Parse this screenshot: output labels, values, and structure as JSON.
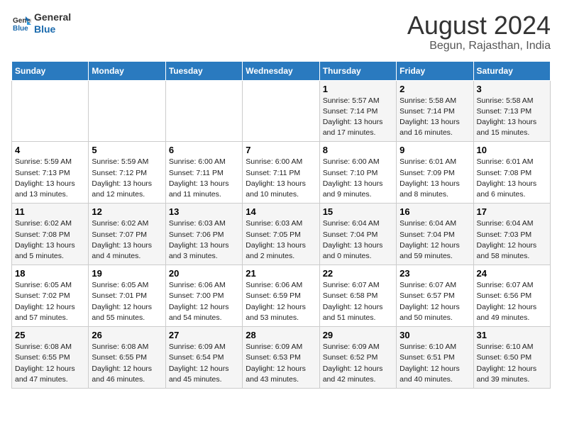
{
  "logo": {
    "line1": "General",
    "line2": "Blue"
  },
  "title": "August 2024",
  "subtitle": "Begun, Rajasthan, India",
  "header_days": [
    "Sunday",
    "Monday",
    "Tuesday",
    "Wednesday",
    "Thursday",
    "Friday",
    "Saturday"
  ],
  "weeks": [
    [
      {
        "day": "",
        "info": ""
      },
      {
        "day": "",
        "info": ""
      },
      {
        "day": "",
        "info": ""
      },
      {
        "day": "",
        "info": ""
      },
      {
        "day": "1",
        "info": "Sunrise: 5:57 AM\nSunset: 7:14 PM\nDaylight: 13 hours\nand 17 minutes."
      },
      {
        "day": "2",
        "info": "Sunrise: 5:58 AM\nSunset: 7:14 PM\nDaylight: 13 hours\nand 16 minutes."
      },
      {
        "day": "3",
        "info": "Sunrise: 5:58 AM\nSunset: 7:13 PM\nDaylight: 13 hours\nand 15 minutes."
      }
    ],
    [
      {
        "day": "4",
        "info": "Sunrise: 5:59 AM\nSunset: 7:13 PM\nDaylight: 13 hours\nand 13 minutes."
      },
      {
        "day": "5",
        "info": "Sunrise: 5:59 AM\nSunset: 7:12 PM\nDaylight: 13 hours\nand 12 minutes."
      },
      {
        "day": "6",
        "info": "Sunrise: 6:00 AM\nSunset: 7:11 PM\nDaylight: 13 hours\nand 11 minutes."
      },
      {
        "day": "7",
        "info": "Sunrise: 6:00 AM\nSunset: 7:11 PM\nDaylight: 13 hours\nand 10 minutes."
      },
      {
        "day": "8",
        "info": "Sunrise: 6:00 AM\nSunset: 7:10 PM\nDaylight: 13 hours\nand 9 minutes."
      },
      {
        "day": "9",
        "info": "Sunrise: 6:01 AM\nSunset: 7:09 PM\nDaylight: 13 hours\nand 8 minutes."
      },
      {
        "day": "10",
        "info": "Sunrise: 6:01 AM\nSunset: 7:08 PM\nDaylight: 13 hours\nand 6 minutes."
      }
    ],
    [
      {
        "day": "11",
        "info": "Sunrise: 6:02 AM\nSunset: 7:08 PM\nDaylight: 13 hours\nand 5 minutes."
      },
      {
        "day": "12",
        "info": "Sunrise: 6:02 AM\nSunset: 7:07 PM\nDaylight: 13 hours\nand 4 minutes."
      },
      {
        "day": "13",
        "info": "Sunrise: 6:03 AM\nSunset: 7:06 PM\nDaylight: 13 hours\nand 3 minutes."
      },
      {
        "day": "14",
        "info": "Sunrise: 6:03 AM\nSunset: 7:05 PM\nDaylight: 13 hours\nand 2 minutes."
      },
      {
        "day": "15",
        "info": "Sunrise: 6:04 AM\nSunset: 7:04 PM\nDaylight: 13 hours\nand 0 minutes."
      },
      {
        "day": "16",
        "info": "Sunrise: 6:04 AM\nSunset: 7:04 PM\nDaylight: 12 hours\nand 59 minutes."
      },
      {
        "day": "17",
        "info": "Sunrise: 6:04 AM\nSunset: 7:03 PM\nDaylight: 12 hours\nand 58 minutes."
      }
    ],
    [
      {
        "day": "18",
        "info": "Sunrise: 6:05 AM\nSunset: 7:02 PM\nDaylight: 12 hours\nand 57 minutes."
      },
      {
        "day": "19",
        "info": "Sunrise: 6:05 AM\nSunset: 7:01 PM\nDaylight: 12 hours\nand 55 minutes."
      },
      {
        "day": "20",
        "info": "Sunrise: 6:06 AM\nSunset: 7:00 PM\nDaylight: 12 hours\nand 54 minutes."
      },
      {
        "day": "21",
        "info": "Sunrise: 6:06 AM\nSunset: 6:59 PM\nDaylight: 12 hours\nand 53 minutes."
      },
      {
        "day": "22",
        "info": "Sunrise: 6:07 AM\nSunset: 6:58 PM\nDaylight: 12 hours\nand 51 minutes."
      },
      {
        "day": "23",
        "info": "Sunrise: 6:07 AM\nSunset: 6:57 PM\nDaylight: 12 hours\nand 50 minutes."
      },
      {
        "day": "24",
        "info": "Sunrise: 6:07 AM\nSunset: 6:56 PM\nDaylight: 12 hours\nand 49 minutes."
      }
    ],
    [
      {
        "day": "25",
        "info": "Sunrise: 6:08 AM\nSunset: 6:55 PM\nDaylight: 12 hours\nand 47 minutes."
      },
      {
        "day": "26",
        "info": "Sunrise: 6:08 AM\nSunset: 6:55 PM\nDaylight: 12 hours\nand 46 minutes."
      },
      {
        "day": "27",
        "info": "Sunrise: 6:09 AM\nSunset: 6:54 PM\nDaylight: 12 hours\nand 45 minutes."
      },
      {
        "day": "28",
        "info": "Sunrise: 6:09 AM\nSunset: 6:53 PM\nDaylight: 12 hours\nand 43 minutes."
      },
      {
        "day": "29",
        "info": "Sunrise: 6:09 AM\nSunset: 6:52 PM\nDaylight: 12 hours\nand 42 minutes."
      },
      {
        "day": "30",
        "info": "Sunrise: 6:10 AM\nSunset: 6:51 PM\nDaylight: 12 hours\nand 40 minutes."
      },
      {
        "day": "31",
        "info": "Sunrise: 6:10 AM\nSunset: 6:50 PM\nDaylight: 12 hours\nand 39 minutes."
      }
    ]
  ]
}
